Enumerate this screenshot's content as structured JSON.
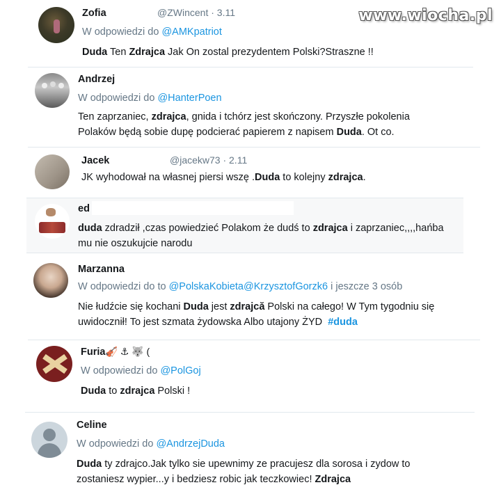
{
  "watermark": "www.wiocha.pl",
  "tweets": [
    {
      "name": "Zofia",
      "handle": "@ZWincent · 3.11",
      "reply_prefix": "W odpowiedzi do",
      "reply_to": "@AMKpatriot",
      "lines": [
        [
          {
            "b": "Duda"
          },
          {
            "t": " Ten "
          },
          {
            "b": "Zdrajca"
          },
          {
            "t": " Jak On zostal prezydentem Polski?Straszne !!"
          }
        ]
      ]
    },
    {
      "name": "Andrzej",
      "reply_prefix": "W odpowiedzi do",
      "reply_to": "@HanterPoen",
      "lines": [
        [
          {
            "t": "Ten zaprzaniec, "
          },
          {
            "b": "zdrajca"
          },
          {
            "t": ", gnida i tchórz jest skończony. Przyszłe pokolenia"
          }
        ],
        [
          {
            "t": "Polaków będą sobie dupę podcierać papierem z napisem "
          },
          {
            "b": "Duda"
          },
          {
            "t": ". Ot co."
          }
        ]
      ]
    },
    {
      "name": "Jacek",
      "handle": "@jacekw73 · 2.11",
      "lines": [
        [
          {
            "t": "JK wyhodował na własnej piersi wszę ."
          },
          {
            "b": "Duda"
          },
          {
            "t": " to kolejny "
          },
          {
            "b": "zdrajca"
          },
          {
            "t": "."
          }
        ]
      ]
    },
    {
      "name": "ed",
      "lines": [
        [
          {
            "b": "duda"
          },
          {
            "t": " zdradził ,czas powiedzieć Polakom że dudś to "
          },
          {
            "b": "zdrajca"
          },
          {
            "t": " i zaprzaniec,,,,hańba"
          }
        ],
        [
          {
            "t": "mu nie oszukujcie narodu"
          }
        ]
      ]
    },
    {
      "name": "Marzanna",
      "reply_prefix": "W odpowiedzi do to",
      "reply_to": "@PolskaKobieta@KrzysztofGorzk6",
      "reply_suffix": " i jeszcze 3 osób",
      "lines": [
        [
          {
            "t": "Nie łudźcie się kochani "
          },
          {
            "b": "Duda"
          },
          {
            "t": " jest "
          },
          {
            "b": "zdrajcă"
          },
          {
            "t": " Polski na całego! W Tym tygodniu się"
          }
        ],
        [
          {
            "t": "uwidocznił! To jest szmata żydowska Albo utajony ŻYD  "
          },
          {
            "h": "#duda"
          }
        ]
      ]
    },
    {
      "name": "Furia",
      "emojis": "🎻 ⚓ 🐺 (",
      "reply_prefix": "W odpowiedzi do",
      "reply_to": "@PolGoj",
      "lines": [
        [
          {
            "b": "Duda"
          },
          {
            "t": " to "
          },
          {
            "b": "zdrajca"
          },
          {
            "t": " Polski !"
          }
        ]
      ]
    },
    {
      "name": "Celine",
      "reply_prefix": "W odpowiedzi do",
      "reply_to": "@AndrzejDuda",
      "lines": [
        [
          {
            "b": "Duda"
          },
          {
            "t": " ty zdrajco.Jak tylko sie upewnimy ze pracujesz dla sorosa i zydow to"
          }
        ],
        [
          {
            "t": "zostaniesz wypier...y i bedziesz robic jak teczkowiec! "
          },
          {
            "b": "Zdrajca"
          }
        ]
      ]
    }
  ]
}
